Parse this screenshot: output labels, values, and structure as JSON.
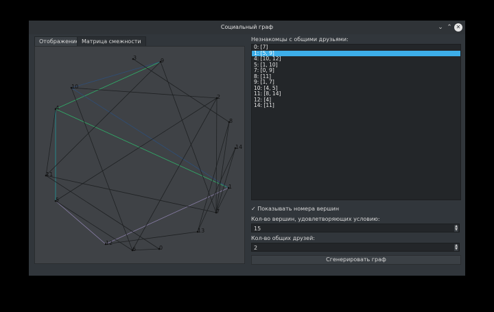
{
  "window": {
    "title": "Социальный граф"
  },
  "tabs": [
    {
      "label": "Отображение"
    },
    {
      "label": "Матрица смежности"
    }
  ],
  "graph": {
    "nodes": [
      "0",
      "1",
      "2",
      "3",
      "4",
      "5",
      "6",
      "7",
      "8",
      "9",
      "10",
      "11",
      "12",
      "13",
      "14"
    ],
    "edges": [
      {
        "a": "9",
        "b": "4",
        "color": "#2fb36a"
      },
      {
        "a": "4",
        "b": "1",
        "color": "#2fb36a"
      },
      {
        "a": "4",
        "b": "5",
        "color": "#1f9a9a"
      },
      {
        "a": "10",
        "b": "9",
        "color": "#2e4f7a"
      },
      {
        "a": "10",
        "b": "1",
        "color": "#2e4f7a"
      },
      {
        "a": "5",
        "b": "12",
        "color": "#8a7fa8"
      },
      {
        "a": "12",
        "b": "1",
        "color": "#8a7fa8"
      },
      {
        "a": "3",
        "b": "8",
        "color": "#1e2022"
      },
      {
        "a": "9",
        "b": "11",
        "color": "#1e2022"
      },
      {
        "a": "9",
        "b": "7",
        "color": "#1e2022"
      },
      {
        "a": "10",
        "b": "2",
        "color": "#1e2022"
      },
      {
        "a": "10",
        "b": "6",
        "color": "#1e2022"
      },
      {
        "a": "2",
        "b": "5",
        "color": "#1e2022"
      },
      {
        "a": "2",
        "b": "7",
        "color": "#1e2022"
      },
      {
        "a": "2",
        "b": "6",
        "color": "#1e2022"
      },
      {
        "a": "8",
        "b": "13",
        "color": "#1e2022"
      },
      {
        "a": "8",
        "b": "7",
        "color": "#1e2022"
      },
      {
        "a": "14",
        "b": "7",
        "color": "#1e2022"
      },
      {
        "a": "14",
        "b": "13",
        "color": "#1e2022"
      },
      {
        "a": "1",
        "b": "7",
        "color": "#1e2022"
      },
      {
        "a": "11",
        "b": "7",
        "color": "#1e2022"
      },
      {
        "a": "11",
        "b": "0",
        "color": "#1e2022"
      },
      {
        "a": "4",
        "b": "11",
        "color": "#1e2022"
      },
      {
        "a": "5",
        "b": "6",
        "color": "#1e2022"
      },
      {
        "a": "12",
        "b": "13",
        "color": "#1e2022"
      },
      {
        "a": "6",
        "b": "0",
        "color": "#1e2022"
      }
    ]
  },
  "strangers": {
    "label": "Незнакомцы с общими друзьями:",
    "items": [
      "0: [7]",
      "1: [5, 9]",
      "4: [10, 12]",
      "5: [1, 10]",
      "7: [0, 9]",
      "8: [11]",
      "9: [1, 7]",
      "10: [4, 5]",
      "11: [8, 14]",
      "12: [4]",
      "14: [11]"
    ],
    "selected_index": 1
  },
  "controls": {
    "show_numbers": {
      "label": "Показывать номера вершин",
      "checked": true,
      "mark": "✓"
    },
    "vertex_count": {
      "label": "Кол-во вершин, удовлетворяющих условию:",
      "value": "15"
    },
    "common_friends": {
      "label": "Кол-во общих друзей:",
      "value": "2"
    },
    "generate": "Сгенерировать граф"
  }
}
